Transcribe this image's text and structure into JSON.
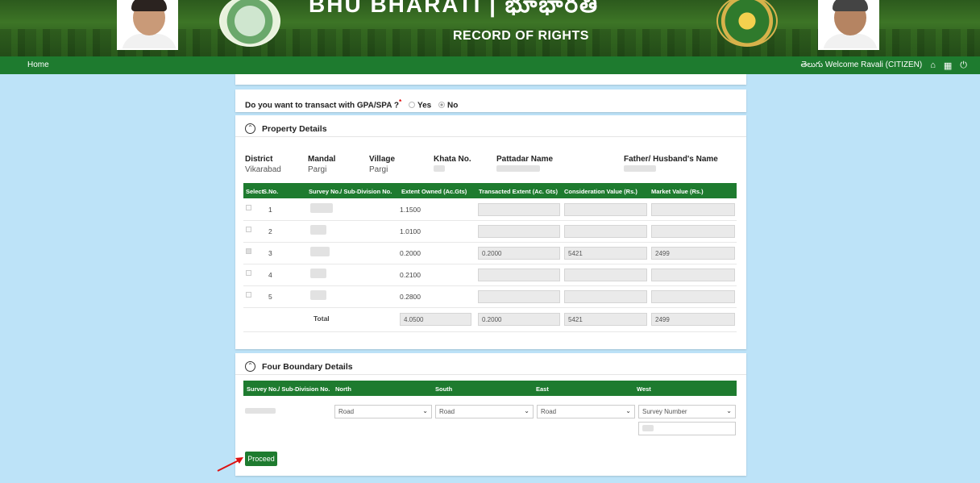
{
  "banner": {
    "title": "BHU BHARATI | భూభారతి",
    "subtitle": "RECORD OF RIGHTS"
  },
  "navbar": {
    "home": "Home",
    "welcome": "తెలుగు Welcome Ravali (CITIZEN)",
    "home_icon": "home-icon",
    "apps_icon": "grid-icon",
    "power_icon": "power-icon"
  },
  "gpa": {
    "question": "Do you want to transact with GPA/SPA ?",
    "required_mark": "*",
    "yes": "Yes",
    "no": "No",
    "selected": "No"
  },
  "property": {
    "section_title": "Property Details",
    "district_label": "District",
    "district_value": "Vikarabad",
    "mandal_label": "Mandal",
    "mandal_value": "Pargi",
    "village_label": "Village",
    "village_value": "Pargi",
    "khata_label": "Khata No.",
    "pattadar_label": "Pattadar Name",
    "father_label": "Father/ Husband's Name",
    "columns": [
      "Select",
      "S.No.",
      "Survey No./ Sub-Division No.",
      "Extent Owned (Ac.Gts)",
      "Transacted Extent (Ac. Gts)",
      "Consideration Value (Rs.)",
      "Market Value (Rs.)"
    ],
    "rows": [
      {
        "sno": "1",
        "extent": "1.1500",
        "transacted": "",
        "consideration": "",
        "market": "",
        "checked": false
      },
      {
        "sno": "2",
        "extent": "1.0100",
        "transacted": "",
        "consideration": "",
        "market": "",
        "checked": false
      },
      {
        "sno": "3",
        "extent": "0.2000",
        "transacted": "0.2000",
        "consideration": "5421",
        "market": "2499",
        "checked": true
      },
      {
        "sno": "4",
        "extent": "0.2100",
        "transacted": "",
        "consideration": "",
        "market": "",
        "checked": false
      },
      {
        "sno": "5",
        "extent": "0.2800",
        "transacted": "",
        "consideration": "",
        "market": "",
        "checked": false
      }
    ],
    "total_label": "Total",
    "total_extent": "4.0500",
    "total_transacted": "0.2000",
    "total_consideration": "5421",
    "total_market": "2499"
  },
  "boundary": {
    "section_title": "Four Boundary Details",
    "col_survey": "Survey No./ Sub-Division No.",
    "col_north": "North",
    "col_south": "South",
    "col_east": "East",
    "col_west": "West",
    "north": "Road",
    "south": "Road",
    "east": "Road",
    "west": "Survey Number"
  },
  "actions": {
    "proceed": "Proceed"
  }
}
